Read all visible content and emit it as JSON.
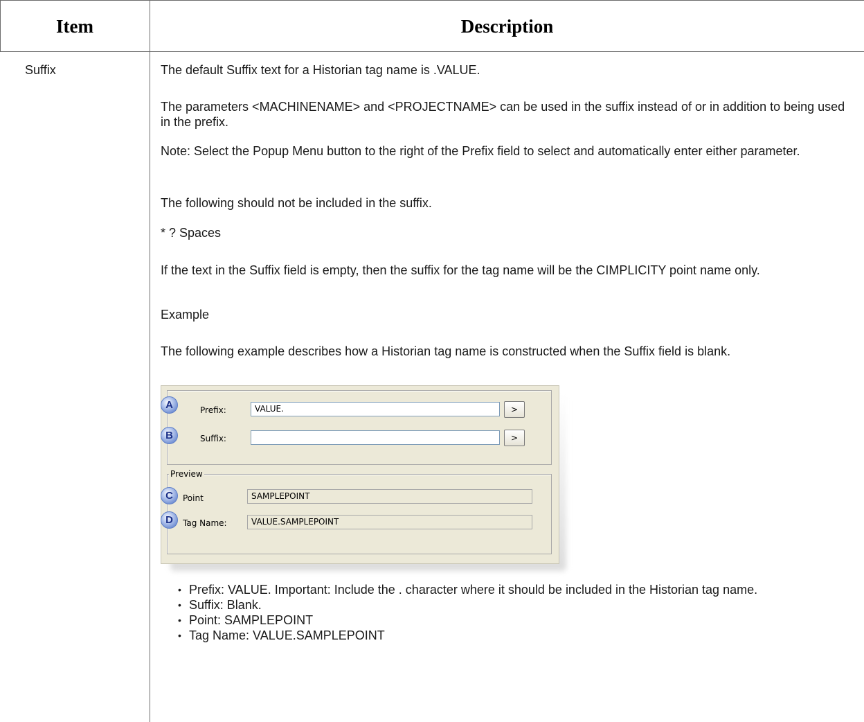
{
  "table": {
    "headers": {
      "item": "Item",
      "description": "Description"
    },
    "row": {
      "item": "Suffix",
      "paragraphs": [
        "The default Suffix text for a Historian tag name is .VALUE.",
        "The parameters <MACHINENAME> and <PROJECTNAME> can be used in the suffix instead of or in addition to being used in the prefix.",
        "Note: Select the Popup Menu button to the right of the Prefix field to select and automatically enter either parameter.",
        "The following should not be included in the suffix.",
        "* ? Spaces",
        "If the text in the Suffix field is empty, then the suffix for the tag name will be the CIMPLICITY point name only.",
        "Example",
        "The following example describes how a Historian tag name is constructed when the Suffix field is blank."
      ],
      "bullets": [
        "Prefix: VALUE. Important: Include the . character where it should be included in the Historian tag name.",
        "Suffix: Blank.",
        "Point: SAMPLEPOINT",
        "Tag Name: VALUE.SAMPLEPOINT"
      ]
    }
  },
  "figure": {
    "callouts": [
      "A",
      "B",
      "C",
      "D"
    ],
    "prefix_label": "Prefix:",
    "prefix_value": "VALUE.",
    "suffix_label": "Suffix:",
    "suffix_value": "",
    "popup_button": ">",
    "preview_label": "Preview",
    "point_label": "Point",
    "point_value": "SAMPLEPOINT",
    "tagname_label": "Tag Name:",
    "tagname_value": "VALUE.SAMPLEPOINT"
  }
}
